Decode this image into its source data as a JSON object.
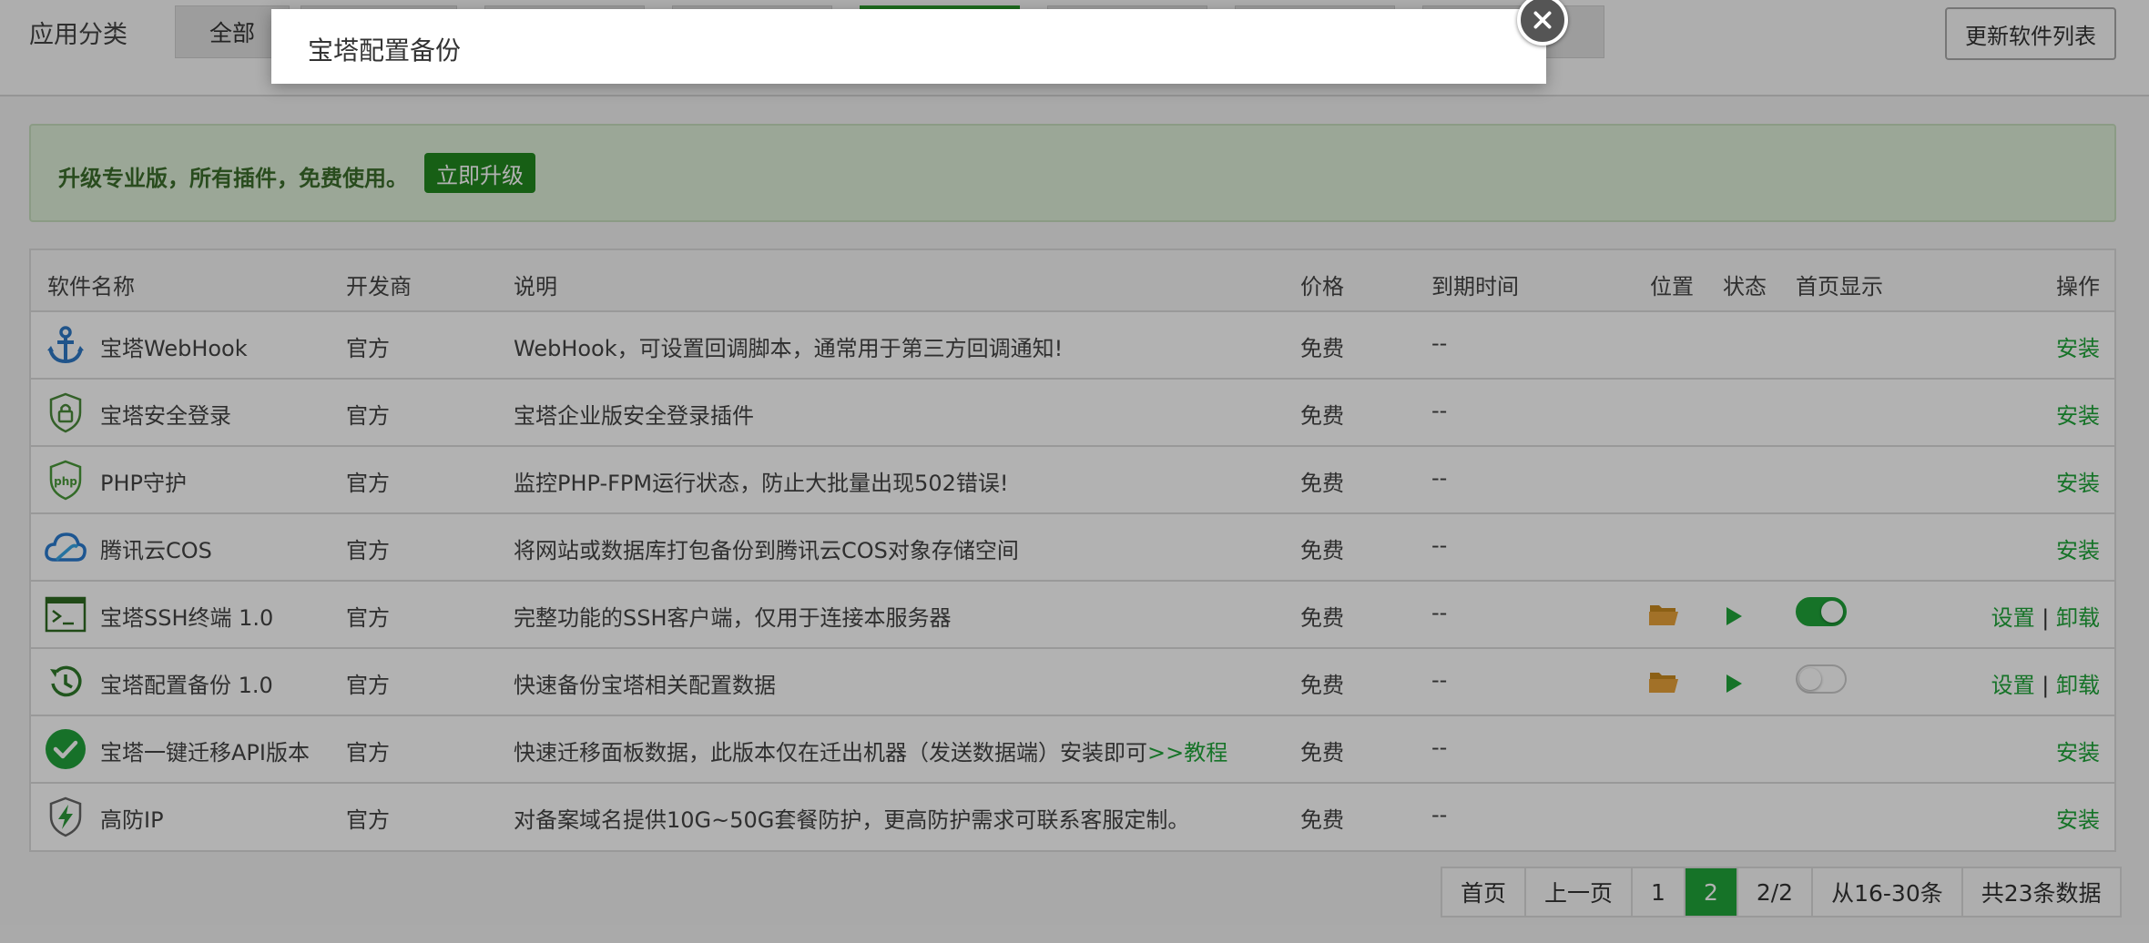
{
  "category": {
    "label": "应用分类",
    "tabs": [
      {
        "label": "全部"
      },
      {
        "label": ""
      },
      {
        "label": ""
      },
      {
        "label": ""
      },
      {
        "label": ""
      },
      {
        "label": ""
      },
      {
        "label": ""
      },
      {
        "label": ""
      }
    ],
    "refresh_label": "更新软件列表"
  },
  "banner": {
    "text": "升级专业版，所有插件，免费使用。",
    "button_label": "立即升级"
  },
  "table": {
    "headers": {
      "name": "软件名称",
      "developer": "开发商",
      "description": "说明",
      "price": "价格",
      "expiry": "到期时间",
      "location": "位置",
      "status": "状态",
      "homepage": "首页显示",
      "operation": "操作"
    },
    "rows": [
      {
        "icon": "anchor-icon",
        "name": "宝塔WebHook",
        "developer": "官方",
        "description": "WebHook，可设置回调脚本，通常用于第三方回调通知!",
        "price": "免费",
        "expiry": "--",
        "op": "安装"
      },
      {
        "icon": "shield-lock-icon",
        "name": "宝塔安全登录",
        "developer": "官方",
        "description": "宝塔企业版安全登录插件",
        "price": "免费",
        "expiry": "--",
        "op": "安装"
      },
      {
        "icon": "php-shield-icon",
        "name": "PHP守护",
        "developer": "官方",
        "description": "监控PHP-FPM运行状态，防止大批量出现502错误!",
        "price": "免费",
        "expiry": "--",
        "op": "安装"
      },
      {
        "icon": "tencent-cloud-icon",
        "name": "腾讯云COS",
        "developer": "官方",
        "description": "将网站或数据库打包备份到腾讯云COS对象存储空间",
        "price": "免费",
        "expiry": "--",
        "op": "安装"
      },
      {
        "icon": "terminal-icon",
        "name": "宝塔SSH终端 1.0",
        "developer": "官方",
        "description": "完整功能的SSH客户端，仅用于连接本服务器",
        "price": "免费",
        "expiry": "--",
        "op_settings": "设置",
        "op_sep": "|",
        "op_uninstall": "卸载",
        "homepage_on": true
      },
      {
        "icon": "backup-clock-icon",
        "name": "宝塔配置备份 1.0",
        "developer": "官方",
        "description": "快速备份宝塔相关配置数据",
        "price": "免费",
        "expiry": "--",
        "op_settings": "设置",
        "op_sep": "|",
        "op_uninstall": "卸载",
        "homepage_on": false
      },
      {
        "icon": "check-circle-icon",
        "name": "宝塔一键迁移API版本",
        "developer": "官方",
        "description": "快速迁移面板数据，此版本仅在迁出机器（发送数据端）安装即可",
        "description_link": ">>教程",
        "price": "免费",
        "expiry": "--",
        "op": "安装"
      },
      {
        "icon": "lightning-shield-icon",
        "name": "高防IP",
        "developer": "官方",
        "description": "对备案域名提供10G~50G套餐防护，更高防护需求可联系客服定制。",
        "price": "免费",
        "expiry": "--",
        "op": "安装"
      }
    ]
  },
  "pagination": {
    "first": "首页",
    "prev": "上一页",
    "page1": "1",
    "page2": "2",
    "page_of": "2/2",
    "range": "从16-30条",
    "total": "共23条数据"
  },
  "modal": {
    "title": "宝塔配置备份"
  },
  "colors": {
    "accent": "#20a53a",
    "banner_bg": "#dff0d8",
    "folder": "#e8a23a"
  }
}
